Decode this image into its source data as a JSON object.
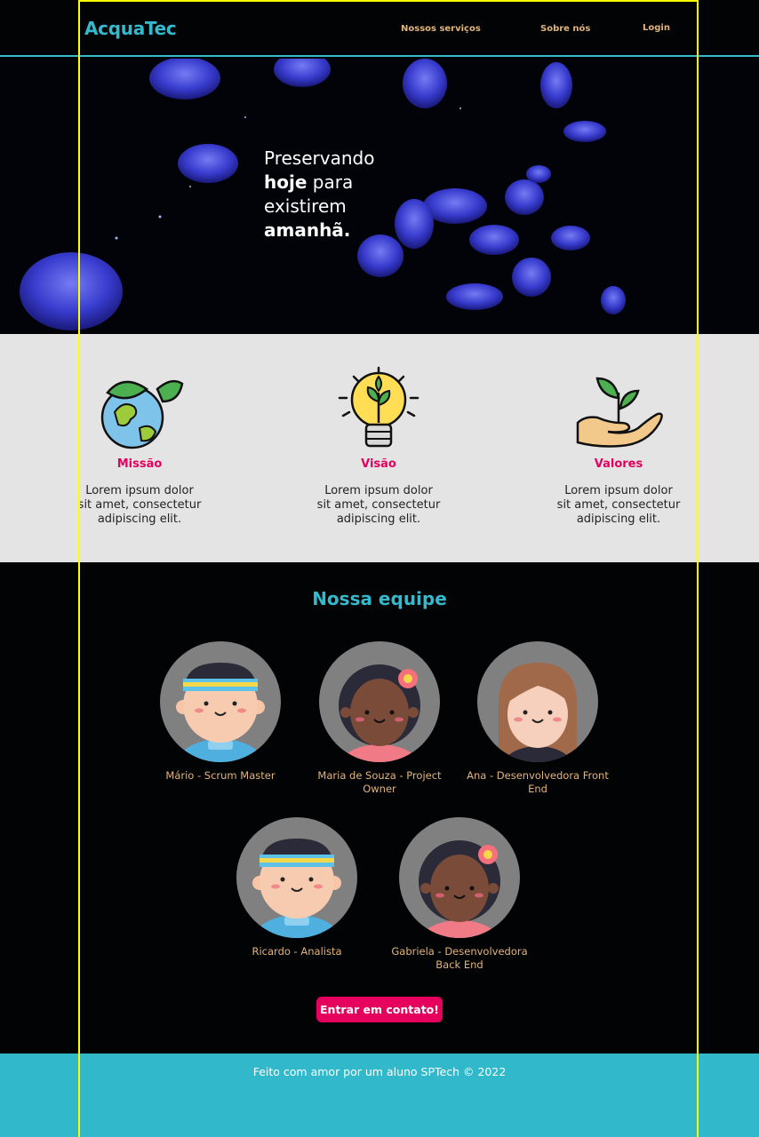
{
  "header": {
    "logo": "AcquaTec",
    "nav": [
      {
        "label": "Nossos serviços"
      },
      {
        "label": "Sobre nós"
      },
      {
        "label": "Login"
      }
    ]
  },
  "hero": {
    "line1": "Preservando",
    "line2_bold": "hoje",
    "line2_rest": " para",
    "line3": "existirem",
    "line4_bold": "amanhã."
  },
  "values": [
    {
      "title": "Missão",
      "text": "Lorem ipsum dolor sit amet, consectetur adipiscing elit.",
      "icon": "earth-leaves-icon"
    },
    {
      "title": "Visão",
      "text": "Lorem ipsum dolor sit amet, consectetur adipiscing elit.",
      "icon": "lightbulb-plant-icon"
    },
    {
      "title": "Valores",
      "text": "Lorem ipsum dolor sit amet, consectetur adipiscing elit.",
      "icon": "hand-sprout-icon"
    }
  ],
  "team": {
    "title": "Nossa equipe",
    "members": [
      {
        "name": "Mário - Scrum Master"
      },
      {
        "name": "Maria de Souza - Project Owner"
      },
      {
        "name": "Ana - Desenvolvedora Front End"
      },
      {
        "name": "Ricardo - Analista"
      },
      {
        "name": "Gabriela - Desenvolvedora Back End"
      }
    ],
    "contact_label": "Entrar em contato!"
  },
  "footer": {
    "text": "Feito com amor por um aluno SPTech © 2022"
  },
  "colors": {
    "accent": "#35b9cc",
    "pink": "#e6005e",
    "nav_gold": "#e2b47a"
  }
}
